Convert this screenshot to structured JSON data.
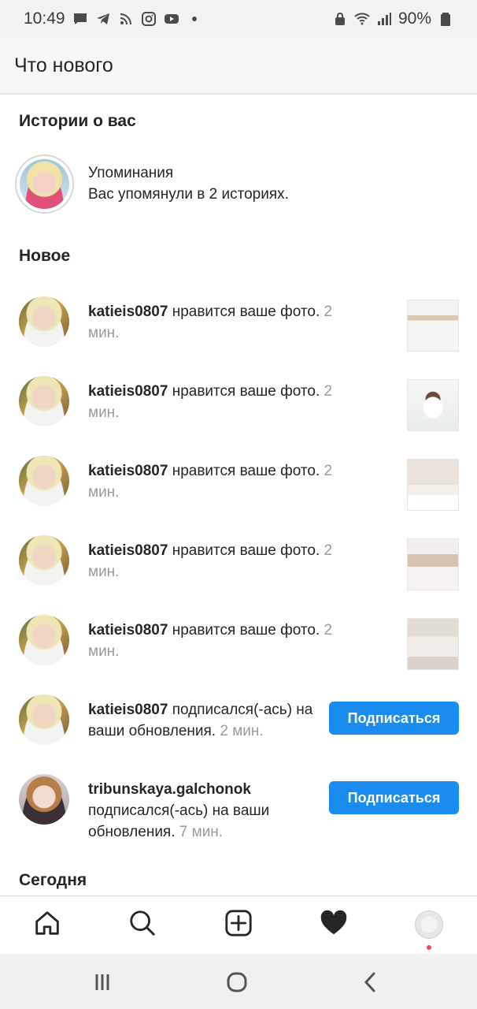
{
  "status_bar": {
    "time": "10:49",
    "battery": "90%",
    "left_icons": [
      "message-icon",
      "telegram-icon",
      "rss-icon",
      "instagram-icon",
      "youtube-icon",
      "dot-icon"
    ],
    "right_icons": [
      "lock-icon",
      "wifi-icon",
      "signal-icon",
      "battery-icon"
    ]
  },
  "header": {
    "title": "Что нового"
  },
  "sections": {
    "stories": "Истории о вас",
    "new": "Новое",
    "today": "Сегодня"
  },
  "mentions": {
    "title": "Упоминания",
    "subtitle": "Вас упомянули в 2 историях."
  },
  "notifications": [
    {
      "user": "katieis0807",
      "action": " нравится ваше фото. ",
      "time": "2 мин."
    },
    {
      "user": "katieis0807",
      "action": " нравится ваше фото. ",
      "time": "2 мин."
    },
    {
      "user": "katieis0807",
      "action": " нравится ваше фото. ",
      "time": "2 мин."
    },
    {
      "user": "katieis0807",
      "action": " нравится ваше фото. ",
      "time": "2 мин."
    },
    {
      "user": "katieis0807",
      "action": " нравится ваше фото. ",
      "time": "2 мин."
    },
    {
      "user": "katieis0807",
      "action": " подписался(-ась) на ваши обновления. ",
      "time": "2 мин.",
      "button": "Подписаться"
    },
    {
      "user": "tribunskaya.galchonok",
      "action": " подписался(-ась) на ваши обновления. ",
      "time": "7 мин.",
      "button": "Подписаться"
    }
  ],
  "tab_bar": {
    "items": [
      "home-icon",
      "search-icon",
      "new-post-icon",
      "activity-heart-icon",
      "profile-avatar"
    ]
  },
  "nav_bar": {
    "items": [
      "recents-icon",
      "home-circle-icon",
      "back-icon"
    ]
  },
  "colors": {
    "accent": "#1a8cf0",
    "time_text": "#9a9a9a",
    "notification_dot": "#ed4956"
  }
}
